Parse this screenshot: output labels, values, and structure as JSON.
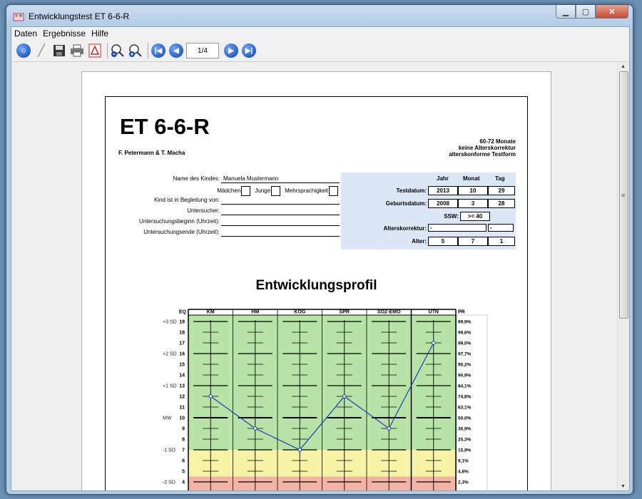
{
  "window": {
    "title": "Entwicklungstest ET 6-6-R"
  },
  "menu": [
    "Daten",
    "Ergebnisse",
    "Hilfe"
  ],
  "toolbar": {
    "page_indicator": "1/4"
  },
  "doc": {
    "title": "ET 6-6-R",
    "authors": "F. Petermann & T. Macha",
    "header_right": [
      "60-72 Monate",
      "keine Alterskorrektur",
      "alterskonforme Testform"
    ],
    "form": {
      "name_label": "Name des Kindes:",
      "name_value": "Manuela Mustermann",
      "maedchen": "Mädchen",
      "junge": "Junge",
      "mehrsprachig": "Mehrsprachigkeit",
      "begleitung": "Kind ist in Begleitung von:",
      "untersucher": "Untersucher:",
      "beginn": "Untersuchungsbeginn (Uhrzeit):",
      "ende": "Untersuchungsende (Uhrzeit):"
    },
    "dates": {
      "col_jahr": "Jahr",
      "col_monat": "Monat",
      "col_tag": "Tag",
      "testdatum_label": "Testdatum:",
      "testdatum": [
        "2013",
        "10",
        "29"
      ],
      "geburtsdatum_label": "Geburtsdatum:",
      "geburtsdatum": [
        "2008",
        "3",
        "28"
      ],
      "ssw_label": "SSW:",
      "ssw": ">= 40",
      "alterskorrektur_label": "Alterskorrektur:",
      "alterskorrektur": [
        "-",
        "-"
      ],
      "alter_label": "Alter:",
      "alter": [
        "5",
        "7",
        "1"
      ]
    },
    "profile_title": "Entwicklungsprofil"
  },
  "chart_data": {
    "type": "line",
    "categories": [
      "KM",
      "HM",
      "KOG",
      "SPR",
      "SOZ-EMO",
      "UTN"
    ],
    "values": [
      12,
      9,
      7,
      12,
      9,
      17
    ],
    "eq_label": "EQ",
    "pr_label": "PR",
    "eq_scale": [
      19,
      18,
      17,
      16,
      15,
      14,
      13,
      12,
      11,
      10,
      9,
      8,
      7,
      6,
      5,
      4
    ],
    "sd_labels": [
      {
        "eq": 19,
        "label": "+3 SD"
      },
      {
        "eq": 16,
        "label": "+2 SD"
      },
      {
        "eq": 13,
        "label": "+1 SD"
      },
      {
        "eq": 10,
        "label": "MW"
      },
      {
        "eq": 7,
        "label": "-1 SD"
      },
      {
        "eq": 4,
        "label": "-2 SD"
      }
    ],
    "pr_values": [
      "99,9%",
      "99,6%",
      "99,0%",
      "97,7%",
      "95,2%",
      "90,9%",
      "84,1%",
      "74,8%",
      "63,1%",
      "50,0%",
      "36,9%",
      "25,3%",
      "15,9%",
      "9,1%",
      "4,8%",
      "2,3%"
    ],
    "bands": [
      {
        "from": 7,
        "to": 19,
        "color": "#b7e3a6"
      },
      {
        "from": 4.5,
        "to": 7,
        "color": "#f7f3a6"
      },
      {
        "from": 3.5,
        "to": 4.5,
        "color": "#f3b3a6"
      }
    ],
    "line_color": "#1a3fb3",
    "ylim": [
      4,
      19
    ]
  }
}
